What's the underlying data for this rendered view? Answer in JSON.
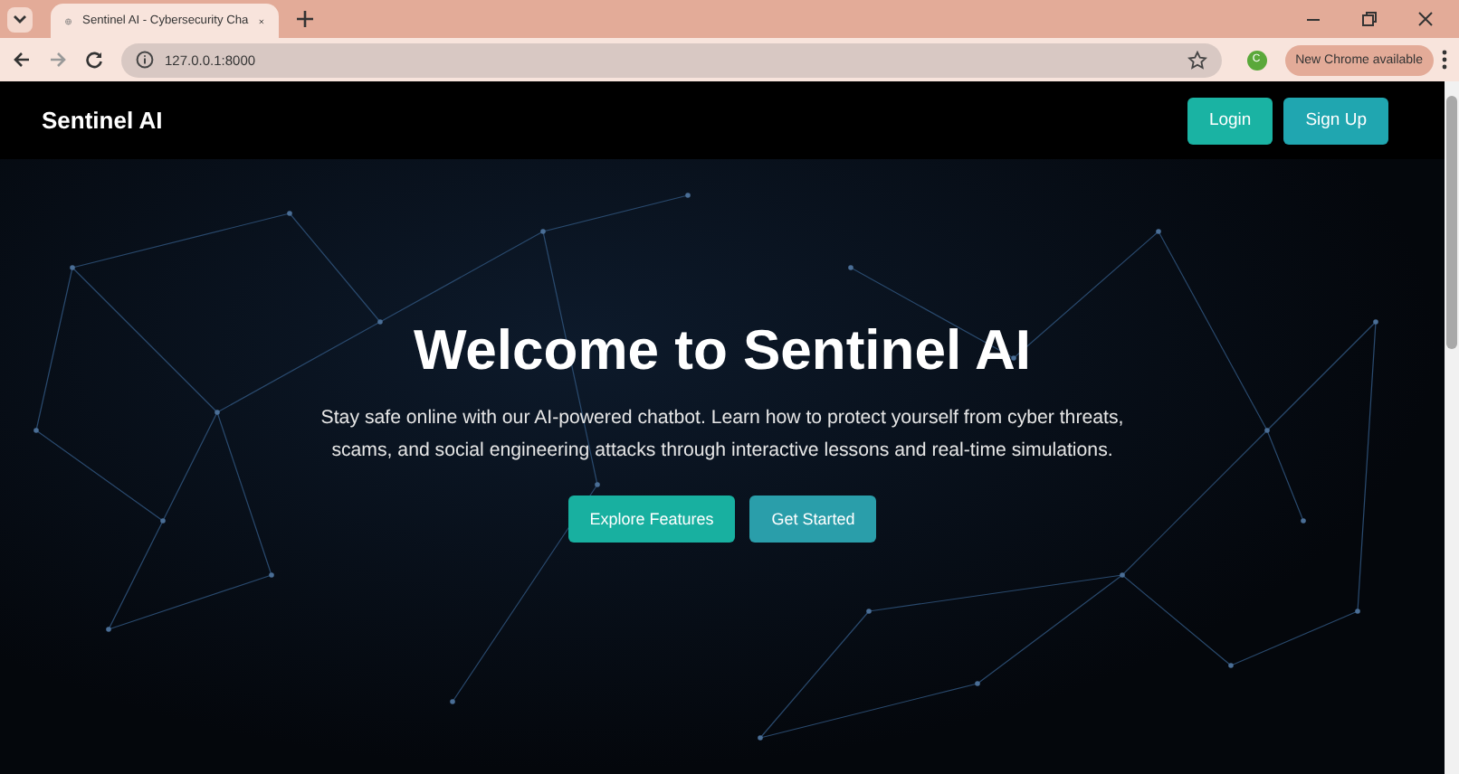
{
  "browser": {
    "tab": {
      "title": "Sentinel AI - Cybersecurity Cha",
      "selected": true
    },
    "address": "127.0.0.1:8000",
    "profile_initial": "C",
    "update_button": "New Chrome available"
  },
  "navbar": {
    "brand": "Sentinel AI",
    "buttons": [
      {
        "label": "Login"
      },
      {
        "label": "Sign Up"
      }
    ]
  },
  "hero": {
    "title": "Welcome to Sentinel AI",
    "text": "Stay safe online with our AI-powered chatbot. Learn how to protect yourself from cyber threats, scams, and social engineering attacks through interactive lessons and real-time simulations.",
    "buttons": [
      {
        "label": "Explore Features",
        "kind": "primary"
      },
      {
        "label": "Get Started",
        "kind": "secondary"
      }
    ]
  }
}
